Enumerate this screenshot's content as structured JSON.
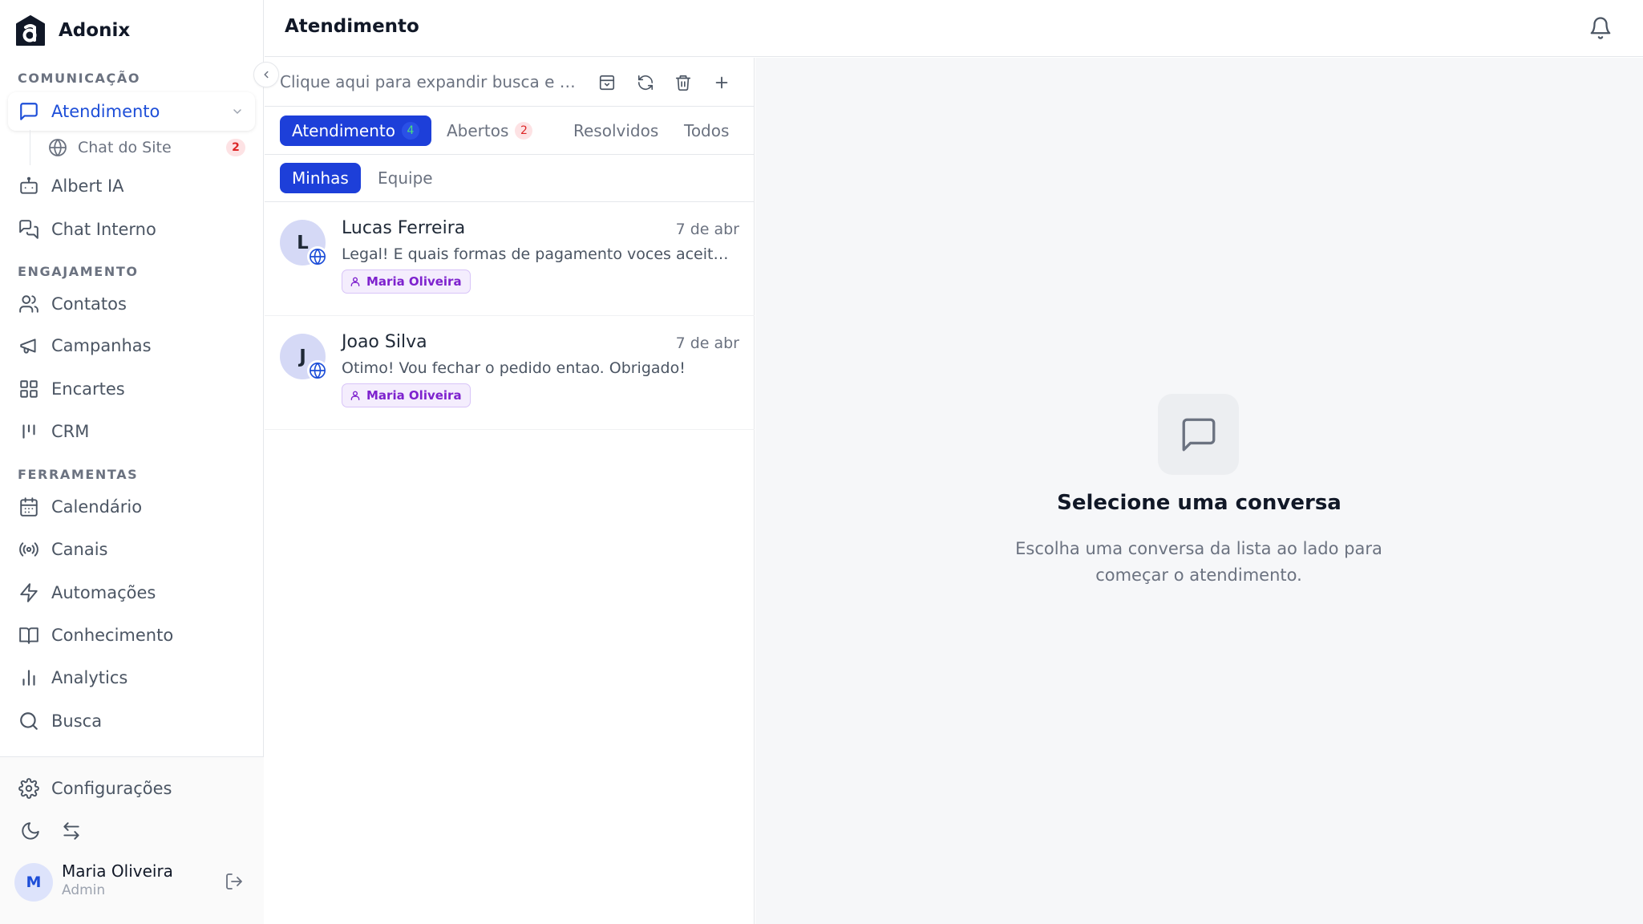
{
  "brand": {
    "name": "Adonix"
  },
  "sidebar": {
    "sections": {
      "comunicacao": "COMUNICAÇÃO",
      "engajamento": "ENGAJAMENTO",
      "ferramentas": "FERRAMENTAS"
    },
    "items": {
      "atendimento": "Atendimento",
      "chat_site": "Chat do Site",
      "chat_site_count": "2",
      "albert": "Albert IA",
      "chat_interno": "Chat Interno",
      "contatos": "Contatos",
      "campanhas": "Campanhas",
      "encartes": "Encartes",
      "crm": "CRM",
      "calendario": "Calendário",
      "canais": "Canais",
      "automacoes": "Automações",
      "conhecimento": "Conhecimento",
      "analytics": "Analytics",
      "busca": "Busca",
      "configuracoes": "Configurações"
    },
    "user": {
      "initial": "M",
      "name": "Maria Oliveira",
      "role": "Admin"
    }
  },
  "header": {
    "title": "Atendimento"
  },
  "list": {
    "search_placeholder": "Clique aqui para expandir busca e filtros",
    "tabs": [
      {
        "label": "Atendimento",
        "count": "4"
      },
      {
        "label": "Abertos",
        "count": "2"
      },
      {
        "label": "Resolvidos"
      },
      {
        "label": "Todos"
      }
    ],
    "subtabs": [
      "Minhas",
      "Equipe"
    ],
    "conversations": [
      {
        "initial": "L",
        "name": "Lucas Ferreira",
        "date": "7 de abr",
        "message": "Legal! E quais formas de pagamento voces aceitam?",
        "agent": "Maria Oliveira"
      },
      {
        "initial": "J",
        "name": "Joao Silva",
        "date": "7 de abr",
        "message": "Otimo! Vou fechar o pedido entao. Obrigado!",
        "agent": "Maria Oliveira"
      }
    ]
  },
  "empty_state": {
    "title": "Selecione uma conversa",
    "subtitle": "Escolha uma conversa da lista ao lado para começar o atendimento."
  },
  "colors": {
    "primary": "#1d3fd9",
    "active_text": "#1d4ed8",
    "badge_red": "#dc2626",
    "tag_purple": "#7e22ce"
  },
  "icons": {
    "atendimento": "message-square-icon",
    "chat_site": "globe-icon",
    "albert": "bot-icon",
    "chat_interno": "messages-icon",
    "contatos": "users-icon",
    "campanhas": "megaphone-icon",
    "encartes": "grid-icon",
    "crm": "kanban-icon",
    "calendario": "calendar-icon",
    "canais": "radio-icon",
    "automacoes": "zap-icon",
    "conhecimento": "book-icon",
    "analytics": "bar-chart-icon",
    "busca": "search-icon",
    "configuracoes": "gear-icon"
  }
}
